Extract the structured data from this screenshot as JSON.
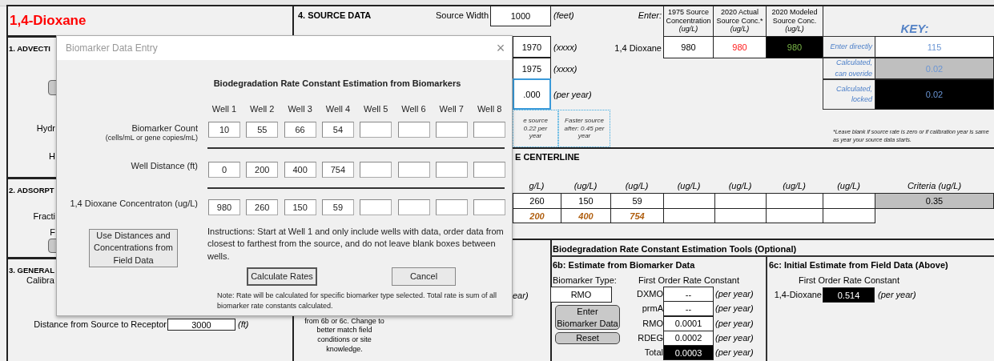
{
  "title": "1,4-Dioxane",
  "left_sections": [
    {
      "heading": "1. ADVECTI",
      "labels": [
        "Hydr",
        "H"
      ]
    },
    {
      "heading": "2. ADSORPT",
      "labels": [
        "Fracti",
        "F"
      ]
    },
    {
      "heading": "3. GENERAL",
      "labels": [
        "Calibra"
      ]
    }
  ],
  "receptor": {
    "label": "Distance from Source to Receptor",
    "value": "3000",
    "unit": "(ft)"
  },
  "source": {
    "heading": "4. SOURCE DATA",
    "width_label": "Source Width",
    "width_value": "1000",
    "width_unit": "(feet)",
    "fields": [
      {
        "value": "1970",
        "unit": "(xxxx)"
      },
      {
        "value": "1975",
        "unit": "(xxxx)"
      },
      {
        "value": ".000",
        "unit": "(per year)"
      }
    ],
    "notes": [
      [
        "e source",
        "0.22 per",
        "year"
      ],
      [
        "Faster source",
        "after:  0.45 per",
        "year"
      ]
    ],
    "enter_label": "Enter:",
    "conc_columns": [
      [
        "1975 Source",
        "Concentration",
        "(ug/L)"
      ],
      [
        "2020  Actual",
        "Source Conc.*",
        "(ug/L)"
      ],
      [
        "2020 Modeled",
        "Source Conc.",
        "(ug/L)"
      ]
    ],
    "conc_row": {
      "label": "1,4 Dioxane",
      "cells": [
        {
          "value": "980",
          "kind": "input"
        },
        {
          "value": "980",
          "kind": "actual"
        },
        {
          "value": "980",
          "kind": "modeled"
        }
      ]
    }
  },
  "key": {
    "title": "KEY:",
    "items": [
      {
        "label": "Enter directly",
        "value": "115",
        "kind": "input"
      },
      {
        "label": "Calculated, can overide",
        "value": "0.02",
        "kind": "calculated"
      },
      {
        "label": "Calculated, locked",
        "value": "0.02",
        "kind": "locked"
      }
    ],
    "footnote": "*Leave blank if source rate is zero or if calibration year is same as year your source data starts."
  },
  "centerline": {
    "heading": "E CENTERLINE",
    "columns": [
      {
        "unit": "g/L)",
        "concentration": "260",
        "distance": "200"
      },
      {
        "unit": "(ug/L)",
        "concentration": "150",
        "distance": "400"
      },
      {
        "unit": "(ug/L)",
        "concentration": "59",
        "distance": "754"
      },
      {
        "unit": "(ug/L)"
      },
      {
        "unit": "(ug/L)"
      },
      {
        "unit": "(ug/L)"
      },
      {
        "unit": "(ug/L)"
      }
    ],
    "criteria": {
      "label": "Criteria (ug/L)",
      "value": "0.35"
    }
  },
  "rate_unit_partial": "ear)",
  "section3_note": [
    "from 6b or 6c. Change to",
    "better match field",
    "conditions or site",
    "knowledge."
  ],
  "tools": {
    "heading": "Biodegradation Rate Constant Estimation Tools (Optional)",
    "biomarker": {
      "heading": "6b: Estimate from Biomarker Data",
      "type_label": "Biomarker Type:",
      "type_value": "RMO",
      "rate_label": "First Order Rate Constant",
      "rates": [
        {
          "label": "DXMO",
          "value": "--",
          "unit": "(per year)",
          "kind": "calculated"
        },
        {
          "label": "prmA",
          "value": "--",
          "unit": "(per year)",
          "kind": "calculated"
        },
        {
          "label": "RMO",
          "value": "0.0001",
          "unit": "(per year)",
          "kind": "calculated"
        },
        {
          "label": "RDEG",
          "value": "0.0002",
          "unit": "(per year)",
          "kind": "calculated"
        },
        {
          "label": "Total",
          "value": "0.0003",
          "unit": "(per year)",
          "kind": "locked"
        }
      ],
      "buttons": [
        "Enter Biomarker Data",
        "Reset"
      ]
    },
    "field": {
      "heading": "6c:  Initial Estimate from Field Data (Above)",
      "rate_label": "First Order Rate Constant",
      "label": "1,4-Dioxane",
      "value": "0.514",
      "unit": "(per year)"
    }
  },
  "dialog": {
    "title": "Biomarker Data Entry",
    "close": "×",
    "heading": "Biodegradation Rate Constant Estimation from Biomarkers",
    "wells": [
      "Well 1",
      "Well 2",
      "Well 3",
      "Well 4",
      "Well 5",
      "Well 6",
      "Well 7",
      "Well 8"
    ],
    "rows": [
      {
        "label": "Biomarker Count",
        "sublabel": "(cells/mL or gene copies/mL)",
        "values": [
          "10",
          "55",
          "66",
          "54"
        ]
      },
      {
        "label": "Well Distance (ft)",
        "values": [
          "0",
          "200",
          "400",
          "754"
        ]
      },
      {
        "label": "1,4 Dioxane Concentraton (ug/L)",
        "values": [
          "980",
          "260",
          "150",
          "59"
        ]
      }
    ],
    "field_button": "Use Distances and Concentrations from Field Data",
    "instructions": "Instructions: Start at Well 1 and only include wells with data, order data from closest to farthest from the source, and do not leave blank boxes between wells.",
    "buttons": [
      "Calculate Rates",
      "Cancel"
    ],
    "note": "Note: Rate will be calculated for specific biomarker type selected. Total rate is sum of all biomarker rate constants calculated."
  }
}
